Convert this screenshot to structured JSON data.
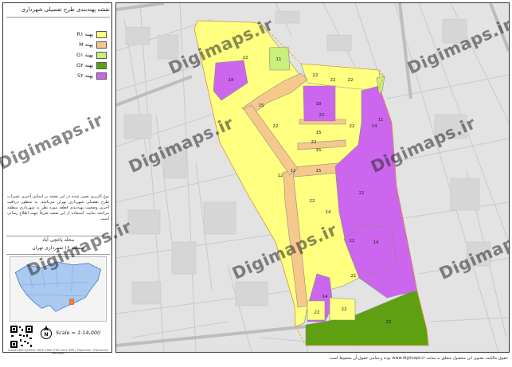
{
  "legend": {
    "title": "نقشه پهنه‌بندی طرح تفصیلی شهرداری",
    "items": [
      {
        "label": "پهنه R۱",
        "color": "#ffff80"
      },
      {
        "label": "پهنه M",
        "color": "#f7c88c"
      },
      {
        "label": "پهنه G۱",
        "color": "#c8f07a"
      },
      {
        "label": "پهنه G۲",
        "color": "#5fa012"
      },
      {
        "label": "پهنه S۲",
        "color": "#cc66ee"
      }
    ]
  },
  "notes": "نوع کاربری تعیین شده در این نقشه بر اساس آخرین تغییرات طرح تفصیلی شهرداری تهران می‌باشد. به منظور دریافت آخرین وضعیت پهنه‌بندی قطعه مورد نظر به شهرداری منطقه مراجعه نمایید. استفاده از این نقشه صرفاً جهت اطلاع رسانی است.",
  "location": {
    "line1": "محله یاخچی آباد",
    "line2": "منطقه ۱۶ شهرداری تهران"
  },
  "scale": "Scale = 1:14,000",
  "panel_footer": "Coordinate System: WGS 1984 UTM Zone 39N | Projection: Transverse Mercator",
  "watermark": "Digimaps.ir",
  "footer_note": "حقوق مالکیت معنوی این محصول متعلق به سایت www.digimaps.ir بوده و تمامی حقوق آن محفوظ است.",
  "map": {
    "zone_labels": [
      "22",
      "11",
      "22",
      "22",
      "22",
      "18",
      "15",
      "22",
      "18",
      "22",
      "14",
      "11",
      "22",
      "15",
      "15",
      "22",
      "12",
      "12",
      "15",
      "22",
      "22",
      "14",
      "22",
      "14",
      "21",
      "14",
      "22",
      "22",
      "22"
    ]
  }
}
